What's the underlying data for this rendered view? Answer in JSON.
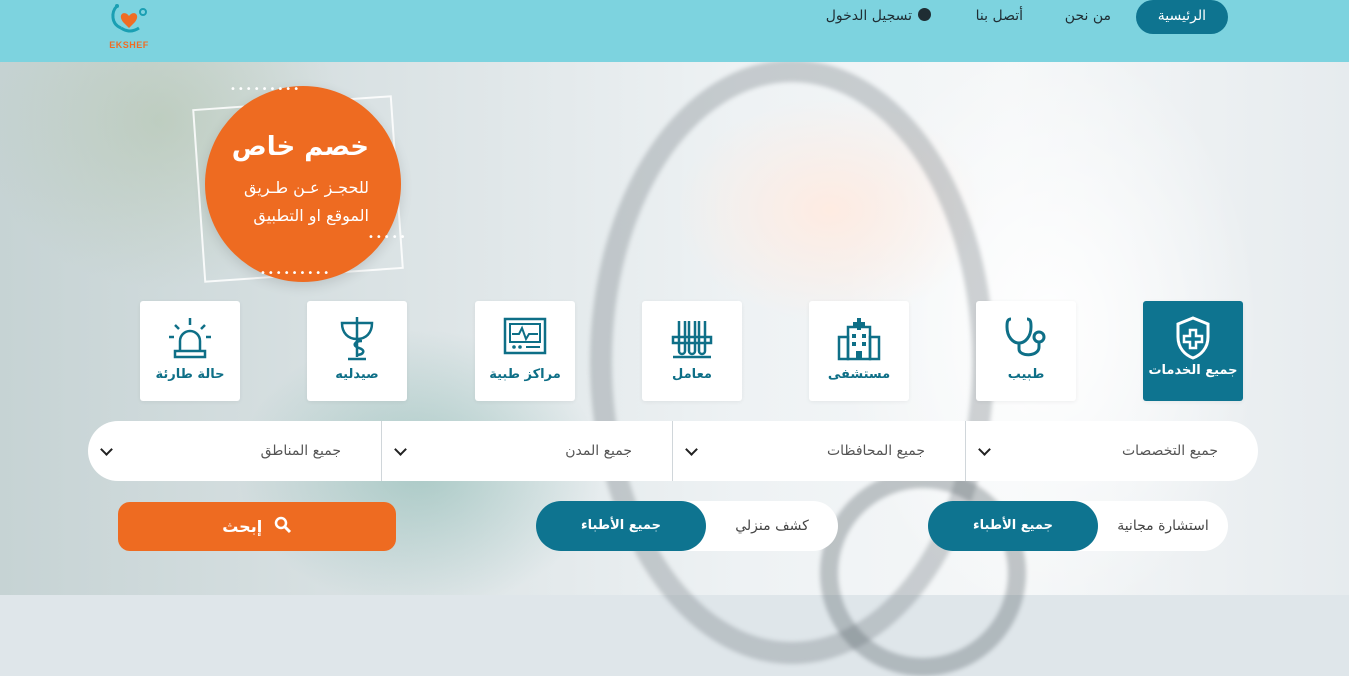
{
  "logo": {
    "text": "EKSHEF"
  },
  "nav": {
    "home": "الرئيسية",
    "about": "من نحن",
    "contact": "أتصل بنا",
    "login": "تسجيل الدخول"
  },
  "promo": {
    "title": "خصم خاص",
    "line1": "للحجـز عـن طـريق",
    "line2": "الموقع او التطبيق"
  },
  "categories": [
    {
      "label": "جميع الخدمات",
      "icon": "shield-plus-icon"
    },
    {
      "label": "طبيب",
      "icon": "stethoscope-icon"
    },
    {
      "label": "مستشفى",
      "icon": "hospital-icon"
    },
    {
      "label": "معامل",
      "icon": "test-tubes-icon"
    },
    {
      "label": "مراكز طبية",
      "icon": "monitor-icon"
    },
    {
      "label": "صيدليه",
      "icon": "pharmacy-icon"
    },
    {
      "label": "حالة طارئة",
      "icon": "siren-icon"
    }
  ],
  "filters": {
    "specialties": "جميع التخصصات",
    "governorates": "جميع المحافظات",
    "cities": "جميع المدن",
    "areas": "جميع المناطق"
  },
  "toggle1": {
    "active": "جميع الأطباء",
    "inactive": "استشارة مجانية"
  },
  "toggle2": {
    "active": "جميع الأطباء",
    "inactive": "كشف منزلي"
  },
  "search": {
    "label": "إبحث"
  },
  "colors": {
    "teal": "#0e7490",
    "header": "#7dd3df",
    "orange": "#ee6b21"
  }
}
